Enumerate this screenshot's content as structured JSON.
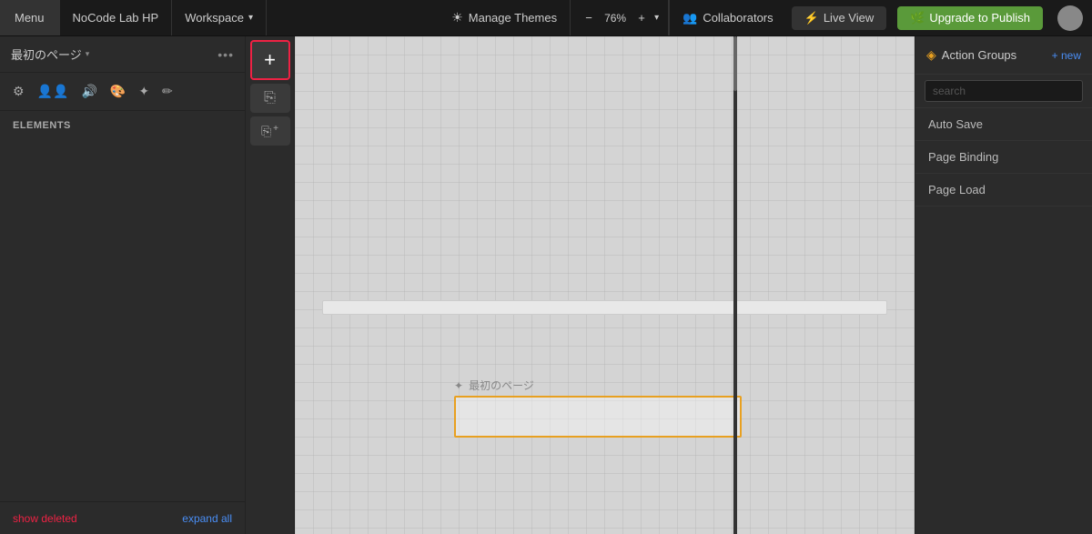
{
  "nav": {
    "menu_label": "Menu",
    "site_name": "NoCode Lab HP",
    "workspace_label": "Workspace",
    "chevron": "▾",
    "sun_icon": "☀",
    "theme_label": "Manage Themes",
    "zoom_minus": "−",
    "zoom_percent": "76%",
    "zoom_plus": "+",
    "zoom_chevron": "▾",
    "collab_icon": "👥",
    "collab_label": "Collaborators",
    "lightning_icon": "⚡",
    "live_label": "Live View",
    "leaf_icon": "🌿",
    "publish_label": "Upgrade to Publish",
    "avatar_text": ""
  },
  "left_panel": {
    "page_name": "最初のページ",
    "page_arrow": "▾",
    "ellipsis": "•••",
    "elements_label": "Elements",
    "footer_left": "show deleted",
    "footer_right": "expand all"
  },
  "toolbar": {
    "settings_icon": "⚙",
    "users_icon": "👥",
    "audio_icon": "🔊",
    "palette_icon": "🎨",
    "move_icon": "✦",
    "edit_icon": "✏"
  },
  "add_element": {
    "plus_btn": "+",
    "copy_icon": "⎘",
    "paste_icon": "⎘+"
  },
  "canvas": {
    "page_label": "最初のページ",
    "move_icon": "✦"
  },
  "right_panel": {
    "title": "Action Groups",
    "new_btn": "+ new",
    "search_placeholder": "search",
    "items": [
      {
        "label": "Auto Save"
      },
      {
        "label": "Page Binding"
      },
      {
        "label": "Page Load"
      }
    ]
  },
  "colors": {
    "accent_orange": "#e8a020",
    "accent_blue": "#4a8ef5",
    "accent_red": "#e24040",
    "bg_dark": "#2b2b2b",
    "bg_darker": "#1a1a1a",
    "nav_bg": "#1a1a1a"
  }
}
